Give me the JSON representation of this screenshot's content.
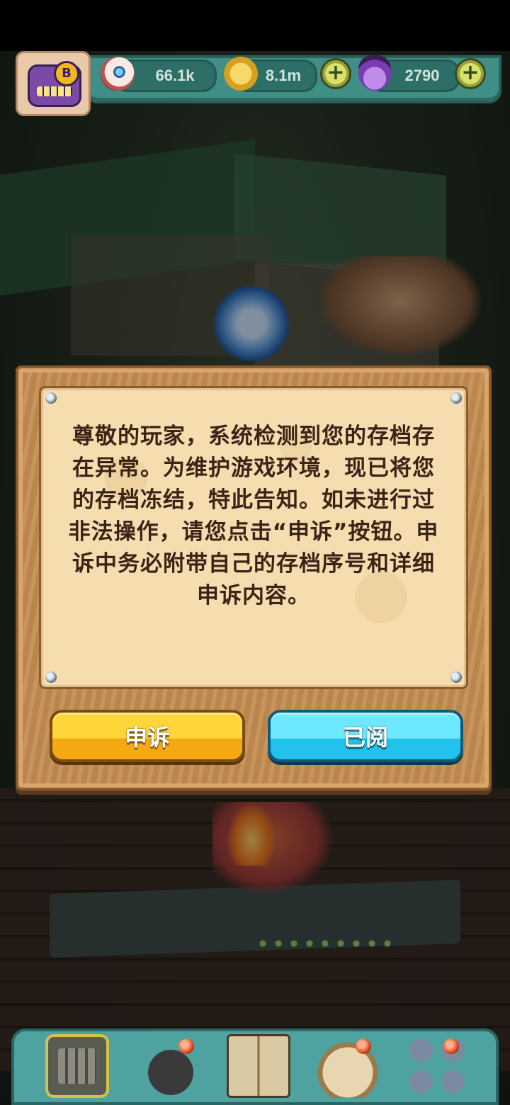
{
  "resources": {
    "eyes": "66.1k",
    "coins": "8.1m",
    "potions": "2790"
  },
  "player": {
    "rank_badge": "B"
  },
  "modal": {
    "message": "尊敬的玩家，系统检测到您的存档存在异常。为维护游戏环境，现已将您的存档冻结，特此告知。如未进行过非法操作，请您点击“申诉”按钮。申诉中务必附带自己的存档序号和详细申诉内容。",
    "appeal_label": "申诉",
    "read_label": "已阅"
  },
  "icons": {
    "resource_1": "eyeball-icon",
    "resource_2": "gold-coin-icon",
    "resource_3": "potion-flask-icon",
    "add": "plus-icon"
  },
  "colors": {
    "appeal_button": "#f4b81c",
    "read_button": "#3ad4f4",
    "parchment": "#f5ddb0",
    "frame_wood": "#c48d52",
    "resource_bar": "#3f8f86"
  }
}
